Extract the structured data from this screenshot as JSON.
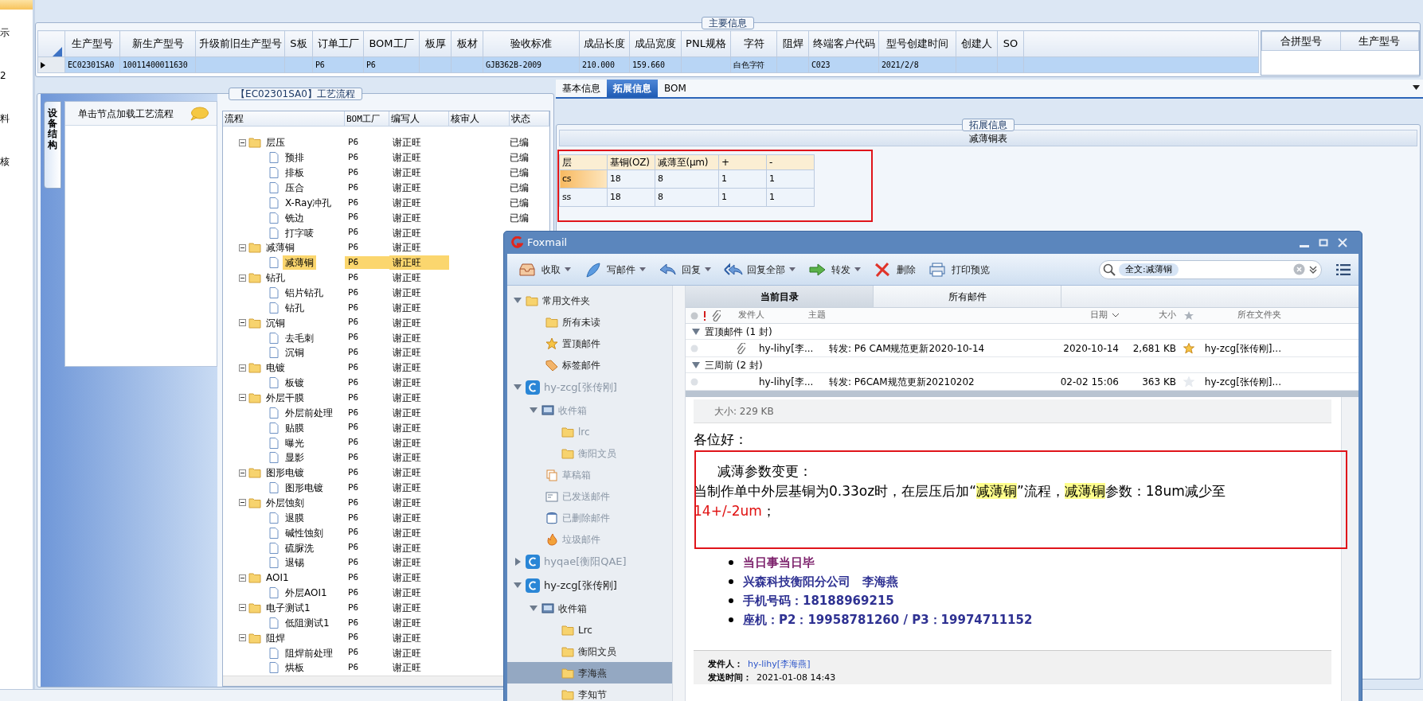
{
  "sidebar": {
    "items": [
      {
        "selected": true
      },
      {
        "label": "示",
        "selected": false
      },
      {
        "label": "2",
        "selected": false
      },
      {
        "label": "料",
        "selected": false
      },
      {
        "label": "核",
        "selected": false
      }
    ]
  },
  "main_info": {
    "title": "主要信息",
    "columns": [
      "生产型号",
      "新生产型号",
      "升级前旧生产型号",
      "S板",
      "订单工厂",
      "BOM工厂",
      "板厚",
      "板材",
      "验收标准",
      "成品长度",
      "成品宽度",
      "PNL规格",
      "字符",
      "阻焊",
      "终端客户代码",
      "型号创建时间",
      "创建人",
      "SO"
    ],
    "rows": [
      {
        "selected": true,
        "cells": [
          "EC02301SA0",
          "10011400011630",
          null,
          null,
          "P6",
          "P6",
          null,
          null,
          "GJB362B-2009",
          "210.000",
          "159.660",
          null,
          "白色字符",
          null,
          "C023",
          "2021/2/8",
          null,
          null
        ]
      }
    ],
    "merge_columns": [
      "合拼型号",
      "生产型号"
    ]
  },
  "process": {
    "title": "【EC02301SA0】工艺流程",
    "side_tab": "设备结构",
    "hint": "单击节点加载工艺流程",
    "columns": [
      "流程",
      "BOM工厂",
      "编写人",
      "核审人",
      "状态"
    ],
    "nodes": [
      {
        "label": "层压",
        "bom": "P6",
        "author": "谢正旺",
        "status": "已编",
        "expanded": true,
        "selected": false,
        "children": [
          {
            "label": "预排",
            "bom": "P6",
            "author": "谢正旺",
            "status": "已编",
            "selected": false
          },
          {
            "label": "排板",
            "bom": "P6",
            "author": "谢正旺",
            "status": "已编",
            "selected": false
          },
          {
            "label": "压合",
            "bom": "P6",
            "author": "谢正旺",
            "status": "已编",
            "selected": false
          },
          {
            "label": "X-Ray冲孔",
            "bom": "P6",
            "author": "谢正旺",
            "status": "已编",
            "selected": false
          },
          {
            "label": "铣边",
            "bom": "P6",
            "author": "谢正旺",
            "status": "已编",
            "selected": false
          },
          {
            "label": "打字唛",
            "bom": "P6",
            "author": "谢正旺",
            "selected": false
          }
        ]
      },
      {
        "label": "减薄铜",
        "bom": "P6",
        "author": "谢正旺",
        "expanded": true,
        "selected": false,
        "children": [
          {
            "label": "减薄铜",
            "bom": "P6",
            "author": "谢正旺",
            "selected": true
          }
        ]
      },
      {
        "label": "钻孔",
        "bom": "P6",
        "author": "谢正旺",
        "expanded": true,
        "selected": false,
        "children": [
          {
            "label": "铝片钻孔",
            "bom": "P6",
            "author": "谢正旺",
            "selected": false
          },
          {
            "label": "钻孔",
            "bom": "P6",
            "author": "谢正旺",
            "selected": false
          }
        ]
      },
      {
        "label": "沉铜",
        "bom": "P6",
        "author": "谢正旺",
        "expanded": true,
        "selected": false,
        "children": [
          {
            "label": "去毛刺",
            "bom": "P6",
            "author": "谢正旺",
            "selected": false
          },
          {
            "label": "沉铜",
            "bom": "P6",
            "author": "谢正旺",
            "selected": false
          }
        ]
      },
      {
        "label": "电镀",
        "bom": "P6",
        "author": "谢正旺",
        "expanded": true,
        "selected": false,
        "children": [
          {
            "label": "板镀",
            "bom": "P6",
            "author": "谢正旺",
            "selected": false
          }
        ]
      },
      {
        "label": "外层干膜",
        "bom": "P6",
        "author": "谢正旺",
        "expanded": true,
        "selected": false,
        "children": [
          {
            "label": "外层前处理",
            "bom": "P6",
            "author": "谢正旺",
            "selected": false
          },
          {
            "label": "贴膜",
            "bom": "P6",
            "author": "谢正旺",
            "selected": false
          },
          {
            "label": "曝光",
            "bom": "P6",
            "author": "谢正旺",
            "selected": false
          },
          {
            "label": "显影",
            "bom": "P6",
            "author": "谢正旺",
            "selected": false
          }
        ]
      },
      {
        "label": "图形电镀",
        "bom": "P6",
        "author": "谢正旺",
        "expanded": true,
        "selected": false,
        "children": [
          {
            "label": "图形电镀",
            "bom": "P6",
            "author": "谢正旺",
            "selected": false
          }
        ]
      },
      {
        "label": "外层蚀刻",
        "bom": "P6",
        "author": "谢正旺",
        "expanded": true,
        "selected": false,
        "children": [
          {
            "label": "退膜",
            "bom": "P6",
            "author": "谢正旺",
            "selected": false
          },
          {
            "label": "碱性蚀刻",
            "bom": "P6",
            "author": "谢正旺",
            "selected": false
          },
          {
            "label": "硫脲洗",
            "bom": "P6",
            "author": "谢正旺",
            "selected": false
          },
          {
            "label": "退锡",
            "bom": "P6",
            "author": "谢正旺",
            "selected": false
          }
        ]
      },
      {
        "label": "AOI1",
        "bom": "P6",
        "author": "谢正旺",
        "expanded": true,
        "selected": false,
        "children": [
          {
            "label": "外层AOI1",
            "bom": "P6",
            "author": "谢正旺",
            "selected": false
          }
        ]
      },
      {
        "label": "电子测试1",
        "bom": "P6",
        "author": "谢正旺",
        "expanded": true,
        "selected": false,
        "children": [
          {
            "label": "低阻测试1",
            "bom": "P6",
            "author": "谢正旺",
            "selected": false
          }
        ]
      },
      {
        "label": "阻焊",
        "bom": "P6",
        "author": "谢正旺",
        "expanded": true,
        "selected": false,
        "children": [
          {
            "label": "阻焊前处理",
            "bom": "P6",
            "author": "谢正旺",
            "selected": false
          },
          {
            "label": "烘板",
            "bom": "P6",
            "author": "谢正旺",
            "selected": false
          }
        ]
      }
    ]
  },
  "details": {
    "tabs": [
      {
        "label": "基本信息",
        "selected": false
      },
      {
        "label": "拓展信息",
        "selected": true
      },
      {
        "label": "BOM",
        "selected": false
      }
    ],
    "group_title": "拓展信息",
    "table_title": "减薄铜表",
    "columns": [
      "层",
      "基铜(OZ)",
      "减薄至(μm)",
      "+",
      "-"
    ],
    "rows": [
      {
        "selected": true,
        "cells": [
          "cs",
          "18",
          "8",
          "1",
          "1"
        ]
      },
      {
        "selected": false,
        "cells": [
          "ss",
          "18",
          "8",
          "1",
          "1"
        ]
      }
    ]
  },
  "foxmail": {
    "title": "Foxmail",
    "toolbar": [
      {
        "label": "收取",
        "kind": "receive",
        "dropdown": true
      },
      {
        "label": "写邮件",
        "kind": "compose",
        "dropdown": true
      },
      {
        "label": "回复",
        "kind": "reply",
        "dropdown": true
      },
      {
        "label": "回复全部",
        "kind": "reply_all",
        "dropdown": true
      },
      {
        "label": "转发",
        "kind": "forward",
        "dropdown": true
      },
      {
        "label": "删除",
        "kind": "delete",
        "dropdown": false
      },
      {
        "label": "打印预览",
        "kind": "print",
        "dropdown": false
      }
    ],
    "search": {
      "token": "全文:减薄铜"
    },
    "folders": [
      {
        "label": "常用文件夹",
        "kind": "folder",
        "expanded": true,
        "greyed": false,
        "selected": false,
        "children": [
          {
            "label": "所有未读",
            "kind": "folder",
            "greyed": false,
            "selected": false
          },
          {
            "label": "置顶邮件",
            "kind": "star",
            "greyed": false,
            "selected": false
          },
          {
            "label": "标签邮件",
            "kind": "tag",
            "greyed": false,
            "selected": false
          }
        ]
      },
      {
        "label": "hy-zcg[张传刚]",
        "kind": "account",
        "expanded": true,
        "greyed": true,
        "selected": false,
        "children": [
          {
            "label": "收件箱",
            "kind": "inbox",
            "expanded": true,
            "greyed": true,
            "selected": false,
            "children": [
              {
                "label": "lrc",
                "kind": "folder",
                "greyed": true,
                "selected": false
              },
              {
                "label": "衡阳文员",
                "kind": "folder",
                "greyed": true,
                "selected": false
              }
            ]
          },
          {
            "label": "草稿箱",
            "kind": "drafts",
            "greyed": true,
            "selected": false
          },
          {
            "label": "已发送邮件",
            "kind": "sent",
            "greyed": true,
            "selected": false
          },
          {
            "label": "已删除邮件",
            "kind": "trash",
            "greyed": true,
            "selected": false
          },
          {
            "label": "垃圾邮件",
            "kind": "junk",
            "greyed": true,
            "selected": false
          }
        ]
      },
      {
        "label": "hyqae[衡阳QAE]",
        "kind": "account",
        "expanded": false,
        "greyed": true,
        "selected": false
      },
      {
        "label": "hy-zcg[张传刚]",
        "kind": "account",
        "expanded": true,
        "greyed": false,
        "selected": false,
        "children": [
          {
            "label": "收件箱",
            "kind": "inbox",
            "expanded": true,
            "greyed": false,
            "selected": false,
            "children": [
              {
                "label": "Lrc",
                "kind": "folder",
                "greyed": false,
                "selected": false
              },
              {
                "label": "衡阳文员",
                "kind": "folder",
                "greyed": false,
                "selected": false
              },
              {
                "label": "李海燕",
                "kind": "folder",
                "greyed": false,
                "selected": true
              },
              {
                "label": "李知节",
                "kind": "folder",
                "greyed": false,
                "selected": false
              }
            ]
          }
        ]
      }
    ],
    "list_tabs": [
      {
        "label": "当前目录",
        "selected": true
      },
      {
        "label": "所有邮件",
        "selected": false
      }
    ],
    "list_columns": [
      "发件人",
      "主题",
      "日期",
      "大小",
      "所在文件夹"
    ],
    "groups": [
      {
        "label": "置顶邮件 (1 封)",
        "expanded": true,
        "mails": [
          {
            "sender": "hy-lihy[李...",
            "subject": "转发: P6 CAM规范更新2020-10-14",
            "date": "2020-10-14",
            "size": "2,681 KB",
            "attachment": true,
            "starred": true,
            "folder": "hy-zcg[张传刚]..."
          }
        ]
      },
      {
        "label": "三周前 (2 封)",
        "expanded": true,
        "mails": [
          {
            "sender": "hy-lihy[李...",
            "subject": "转发: P6CAM规范更新20210202",
            "date": "02-02 15:06",
            "size": "363 KB",
            "attachment": false,
            "starred": false,
            "folder": "hy-zcg[张传刚]..."
          }
        ]
      }
    ],
    "message": {
      "size": "大小: 229 KB",
      "greeting": "各位好：",
      "heading": "减薄参数变更：",
      "lines": [
        [
          {
            "text": "当制作单中外层基铜为0.33oz时，在层压后加“",
            "kind": "plain"
          },
          {
            "text": "减薄铜",
            "kind": "highlight"
          },
          {
            "text": "”流程，",
            "kind": "plain"
          },
          {
            "text": "减薄铜",
            "kind": "highlight"
          },
          {
            "text": "参数：18um减少至",
            "kind": "plain"
          }
        ],
        [
          {
            "text": "14+/-2um",
            "kind": "red"
          },
          {
            "text": "；",
            "kind": "plain"
          }
        ]
      ],
      "signature": [
        {
          "text": "当日事当日毕",
          "color": "#7b1f6a"
        },
        {
          "text": "兴森科技衡阳分公司　李海燕",
          "color": "#2e3192"
        },
        {
          "text": "手机号码：18188969215",
          "color": "#2e3192"
        },
        {
          "text": "座机：P2：19958781260 / P3：19974711152",
          "color": "#2e3192"
        }
      ],
      "header": [
        {
          "label": "发件人：",
          "value": "hy-lihy[李海燕]",
          "kind": "link"
        },
        {
          "label": "发送时间：",
          "value": "2021-01-08 14:43",
          "kind": "text"
        }
      ]
    }
  }
}
